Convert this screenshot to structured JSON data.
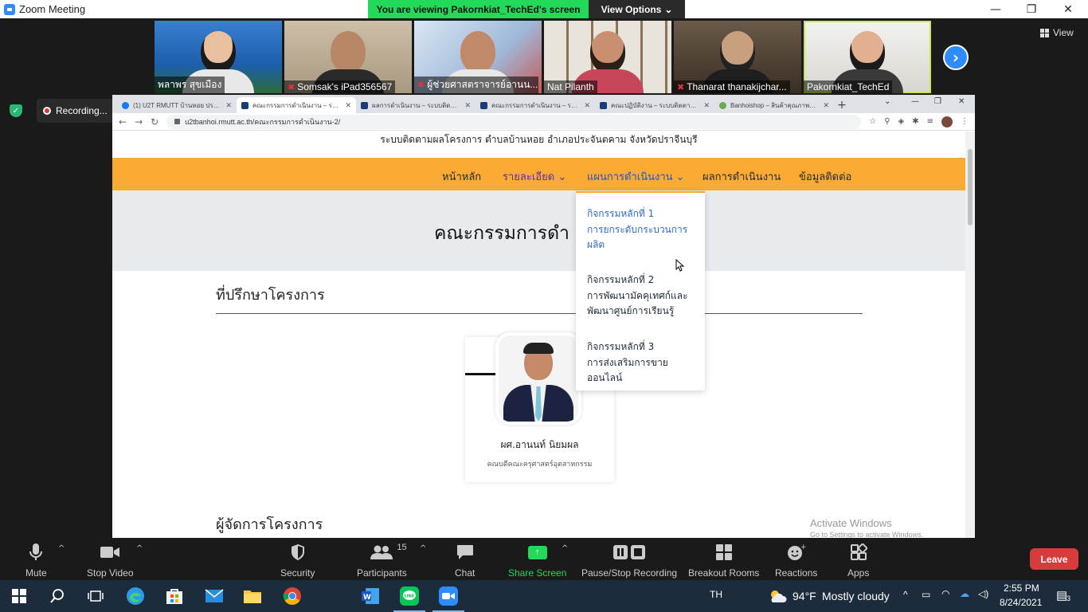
{
  "zoom": {
    "window_title": "Zoom Meeting",
    "viewing_banner": "You are viewing Pakornkiat_TechEd's screen",
    "view_options_label": "View Options",
    "view_label": "View",
    "recording_label": "Recording...",
    "participants": [
      {
        "name": "พลาพร สุขเมือง",
        "muted": false
      },
      {
        "name": "Somsak's iPad356567",
        "muted": true
      },
      {
        "name": "ผู้ช่วยศาสตราจารย์อานน...",
        "muted": true
      },
      {
        "name": "Nat Pilanth",
        "muted": false
      },
      {
        "name": "Thanarat thanakijchar...",
        "muted": true
      },
      {
        "name": "Pakornkiat_TechEd",
        "muted": false
      }
    ],
    "toolbar": {
      "mute": "Mute",
      "stop_video": "Stop Video",
      "security": "Security",
      "participants": "Participants",
      "participants_count": "15",
      "chat": "Chat",
      "share_screen": "Share Screen",
      "pause_stop_recording": "Pause/Stop Recording",
      "breakout_rooms": "Breakout Rooms",
      "reactions": "Reactions",
      "apps": "Apps",
      "leave": "Leave"
    }
  },
  "browser": {
    "tabs": [
      {
        "title": "(1) U2T RMUTT บ้านหอย ประจิณ",
        "active": false
      },
      {
        "title": "คณะกรรมการดำเนินงาน – ระบบติด",
        "active": true
      },
      {
        "title": "ผลการดำเนินงาน – ระบบติดตามผล",
        "active": false
      },
      {
        "title": "คณะกรรมการดำเนินงาน – ระบบติด",
        "active": false
      },
      {
        "title": "คณะปฏิบัติงาน – ระบบติดตามผลโค",
        "active": false
      },
      {
        "title": "Banhoishop – สินค้าคุณภาพจาก",
        "active": false
      }
    ],
    "url": "u2tbanhoi.rmutt.ac.th/คณะกรรมการดำเนินงาน-2/"
  },
  "site": {
    "title": "ระบบติดตามผลโครงการ ตำบลบ้านหอย อำเภอประจันตคาม จังหวัดปราจีนบุรี",
    "menu": {
      "home": "หน้าหลัก",
      "details": "รายละเอียด",
      "plan": "แผนการดำเนินงาน",
      "results": "ผลการดำเนินงาน",
      "contact": "ข้อมูลติดต่อ"
    },
    "dropdown": [
      [
        "กิจกรรมหลักที่ 1",
        "การยกระดับกระบวนการ",
        "ผลิต"
      ],
      [
        "กิจกรรมหลักที่ 2",
        "การพัฒนามัคคุเทศก์และ",
        "พัฒนาศูนย์การเรียนรู้"
      ],
      [
        "กิจกรรมหลักที่ 3",
        "การส่งเสริมการขาย",
        "ออนไลน์"
      ]
    ],
    "hero_title": "คณะกรรมการดำ",
    "section_advisors": "ที่ปรึกษาโครงการ",
    "advisor_name": "ผศ.อานนท์ นิยมผล",
    "advisor_role": "คณบดีคณะครุศาสตร์อุตสาหกรรม",
    "section_managers": "ผู้จัดการโครงการ",
    "activate_line1": "Activate Windows",
    "activate_line2": "Go to Settings to activate Windows."
  },
  "taskbar": {
    "language": "TH",
    "weather_temp": "94°F",
    "weather_text": "Mostly cloudy",
    "time": "2:55 PM",
    "date": "8/24/2021",
    "notifications": "3"
  },
  "colors": {
    "menu_bar": "#fbab33",
    "share_green": "#23d959",
    "leave_red": "#d63c3c",
    "zoom_blue": "#2d8cff"
  }
}
